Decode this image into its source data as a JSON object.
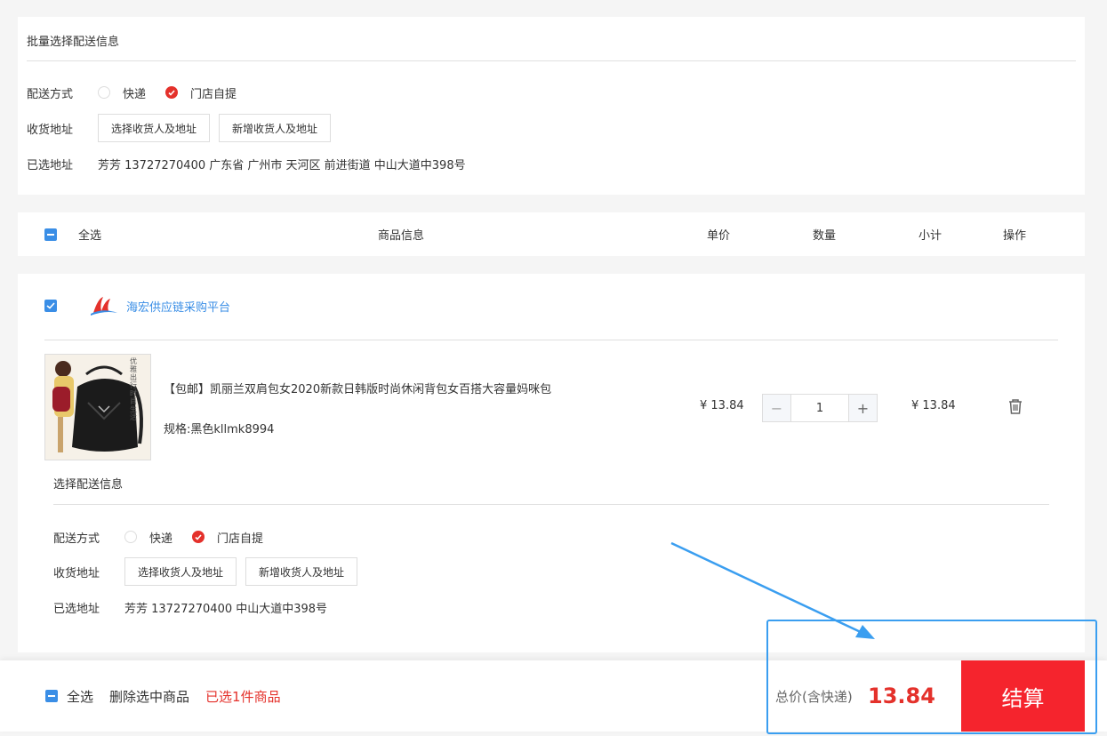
{
  "batch": {
    "title": "批量选择配送信息",
    "delivery_label": "配送方式",
    "opt_express": "快递",
    "opt_pickup": "门店自提",
    "address_label": "收货地址",
    "btn_select": "选择收货人及地址",
    "btn_new": "新增收货人及地址",
    "selected_label": "已选地址",
    "selected_value": "芳芳 13727270400 广东省 广州市 天河区 前进街道 中山大道中398号"
  },
  "header": {
    "select_all": "全选",
    "col_info": "商品信息",
    "col_price": "单价",
    "col_qty": "数量",
    "col_subtotal": "小计",
    "col_action": "操作"
  },
  "shop": {
    "name": "海宏供应链采购平台",
    "item": {
      "name": "【包邮】凯丽兰双肩包女2020新款日韩版时尚休闲背包女百搭大容量妈咪包",
      "spec": "规格:黑色kllmk8994",
      "price": "¥ 13.84",
      "qty": "1",
      "subtotal": "¥ 13.84",
      "thumb_text": "优雅出行 时尚生活"
    },
    "delivery": {
      "title": "选择配送信息",
      "delivery_label": "配送方式",
      "opt_express": "快递",
      "opt_pickup": "门店自提",
      "address_label": "收货地址",
      "btn_select": "选择收货人及地址",
      "btn_new": "新增收货人及地址",
      "selected_label": "已选地址",
      "selected_value": "芳芳 13727270400 中山大道中398号"
    }
  },
  "footer": {
    "select_all": "全选",
    "delete_selected": "删除选中商品",
    "selected_count": "已选1件商品",
    "total_label": "总价(含快递)",
    "total_value": "13.84",
    "checkout": "结算"
  },
  "colors": {
    "accent_red": "#e4312b",
    "checkout_red": "#f5242d",
    "accent_blue": "#3a8ee6",
    "highlight_blue": "#3a9ef0"
  }
}
